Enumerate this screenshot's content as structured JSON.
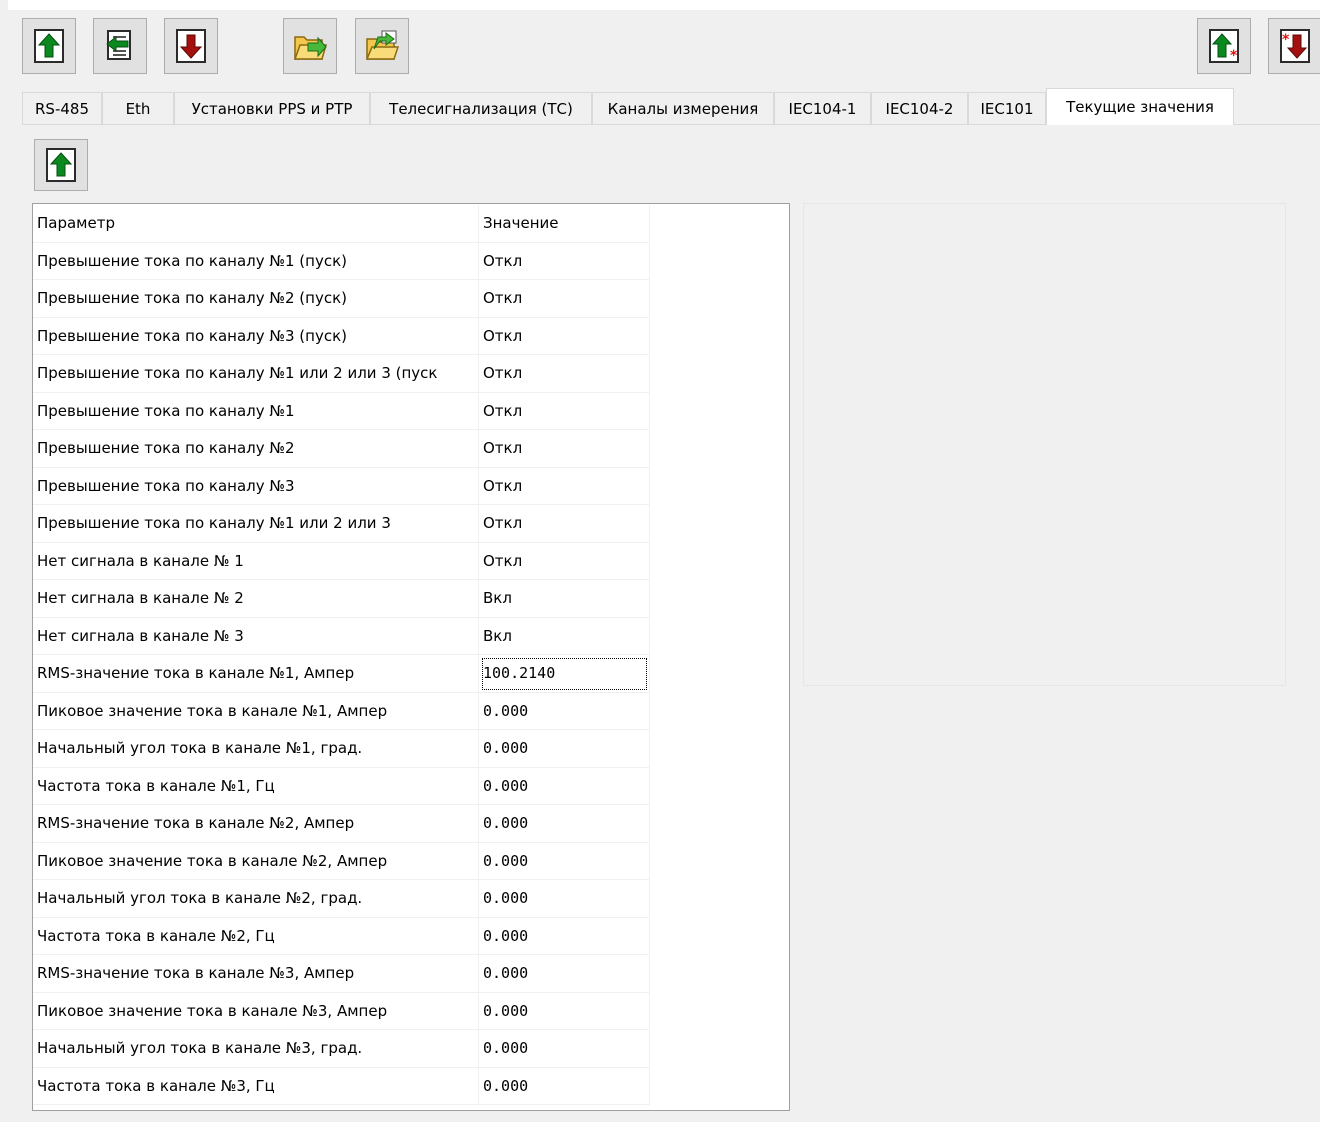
{
  "toolbar": {
    "buttons": [
      {
        "name": "read-button",
        "icon": "green-up-arrow-icon"
      },
      {
        "name": "import-button",
        "icon": "green-left-arrow-doc-icon"
      },
      {
        "name": "write-button",
        "icon": "red-down-arrow-icon"
      },
      {
        "name": "open-file-button",
        "icon": "folder-open-icon"
      },
      {
        "name": "save-file-button",
        "icon": "folder-save-icon"
      },
      {
        "name": "read-all-button",
        "icon": "green-up-arrow-star-icon"
      },
      {
        "name": "write-all-button",
        "icon": "red-down-arrow-star-icon"
      }
    ]
  },
  "tabs": [
    {
      "label": "RS-485"
    },
    {
      "label": "Eth"
    },
    {
      "label": "Установки PPS и PTP"
    },
    {
      "label": "Телесигнализация (ТС)"
    },
    {
      "label": "Каналы измерения"
    },
    {
      "label": "IEC104-1"
    },
    {
      "label": "IEC104-2"
    },
    {
      "label": "IEC101"
    },
    {
      "label": "Текущие значения",
      "active": true
    }
  ],
  "grid": {
    "headers": [
      "Параметр",
      "Значение"
    ],
    "rows": [
      [
        "Превышение тока по каналу №1 (пуск)",
        "Откл"
      ],
      [
        "Превышение тока по каналу №2 (пуск)",
        "Откл"
      ],
      [
        "Превышение тока по каналу №3 (пуск)",
        "Откл"
      ],
      [
        "Превышение тока по каналу №1 или 2 или 3 (пуск",
        "Откл"
      ],
      [
        "Превышение тока по каналу №1",
        "Откл"
      ],
      [
        "Превышение тока по каналу №2",
        "Откл"
      ],
      [
        "Превышение тока по каналу №3",
        "Откл"
      ],
      [
        "Превышение тока по каналу №1 или 2 или 3",
        "Откл"
      ],
      [
        "Нет сигнала в канале № 1",
        "Откл"
      ],
      [
        "Нет сигнала в канале № 2",
        "Вкл"
      ],
      [
        "Нет сигнала в канале № 3",
        "Вкл"
      ],
      [
        "RMS-значение тока в канале №1, Ампер",
        "100.2140"
      ],
      [
        "Пиковое значение тока в канале №1, Ампер",
        "0.000"
      ],
      [
        "Начальный угол тока в канале №1, град.",
        "0.000"
      ],
      [
        "Частота тока в канале №1, Гц",
        "0.000"
      ],
      [
        "RMS-значение тока в канале №2, Ампер",
        "0.000"
      ],
      [
        "Пиковое значение тока в канале №2, Ампер",
        "0.000"
      ],
      [
        "Начальный угол тока в канале №2, град.",
        "0.000"
      ],
      [
        "Частота тока в канале №2, Гц",
        "0.000"
      ],
      [
        "RMS-значение тока в канале №3, Ампер",
        "0.000"
      ],
      [
        "Пиковое значение тока в канале №3, Ампер",
        "0.000"
      ],
      [
        "Начальный угол тока в канале №3, град.",
        "0.000"
      ],
      [
        "Частота тока в канале №3, Гц",
        "0.000"
      ]
    ]
  },
  "colors": {
    "button_face": "#e1e1e1",
    "window_bg": "#f0f0f0",
    "green_arrow": "#0a8a1e",
    "red_arrow": "#a3100e"
  }
}
